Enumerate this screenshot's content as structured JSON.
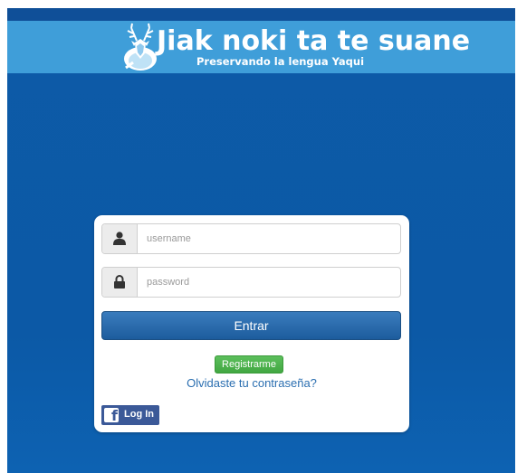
{
  "header": {
    "title": "Jiak noki ta te suane",
    "subtitle": "Preservando la lengua Yaqui",
    "logo": "deer-icon"
  },
  "login": {
    "username_placeholder": "username",
    "username_value": "",
    "username_icon": "user-icon",
    "password_placeholder": "password",
    "password_value": "",
    "password_icon": "lock-icon",
    "submit_label": "Entrar",
    "register_label": "Registrarme",
    "forgot_label": "Olvidaste tu contraseña?",
    "facebook_label": "Log In",
    "facebook_icon": "facebook-icon"
  },
  "colors": {
    "background": "#0c59a6",
    "header": "#3f9ed9",
    "primary_button": "#245f9f",
    "register_button": "#4cae4c",
    "link": "#2a6eb0",
    "facebook": "#3b5998"
  }
}
